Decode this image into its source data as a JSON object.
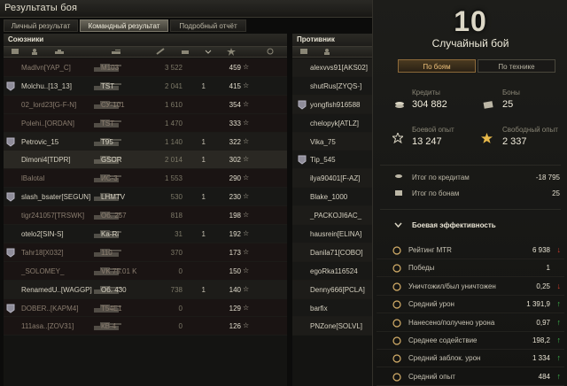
{
  "window": {
    "title": "Результаты боя"
  },
  "tabs": [
    {
      "label": "Личный результат",
      "active": false
    },
    {
      "label": "Командный результат",
      "active": true
    },
    {
      "label": "Подробный отчёт",
      "active": false
    }
  ],
  "allies": {
    "header": "Союзники",
    "rows": [
      {
        "name": "Madlvn[YAP_C]",
        "tank": "M103",
        "damage": "3 522",
        "kills": "",
        "xp": "459",
        "dead": true
      },
      {
        "name": "Molchu..[13_13]",
        "tank": "TST",
        "damage": "2 041",
        "kills": "1",
        "xp": "415",
        "dead": false
      },
      {
        "name": "02_lord23[G-F-N]",
        "tank": "СУ-101",
        "damage": "1 610",
        "kills": "",
        "xp": "354",
        "dead": true
      },
      {
        "name": "Polehi..[ORDAN]",
        "tank": "TST",
        "damage": "1 470",
        "kills": "",
        "xp": "333",
        "dead": true
      },
      {
        "name": "Petrovic_15",
        "tank": "T95",
        "damage": "1 140",
        "kills": "1",
        "xp": "322",
        "dead": false
      },
      {
        "name": "Dimoni4[TDPR]",
        "tank": "GSOR",
        "damage": "2 014",
        "kills": "1",
        "xp": "302",
        "dead": false,
        "me": true
      },
      {
        "name": "lBalotal",
        "tank": "ИС-3",
        "damage": "1 553",
        "kills": "",
        "xp": "290",
        "dead": true
      },
      {
        "name": "slash_bsater[SEGUN]",
        "tank": "LHMTV",
        "damage": "530",
        "kills": "1",
        "xp": "230",
        "dead": false
      },
      {
        "name": "tigr241057[TRSWK]",
        "tank": "Об. 257",
        "damage": "818",
        "kills": "",
        "xp": "198",
        "dead": true
      },
      {
        "name": "otelo2[SIN-S]",
        "tank": "Ka-Ri",
        "damage": "31",
        "kills": "1",
        "xp": "192",
        "dead": false
      },
      {
        "name": "Tahr18[X032]",
        "tank": "110",
        "damage": "370",
        "kills": "",
        "xp": "173",
        "dead": true
      },
      {
        "name": "_SOLOMEY_",
        "tank": "VK 75.01 K",
        "damage": "0",
        "kills": "",
        "xp": "150",
        "dead": true
      },
      {
        "name": "RenamedU..[WAGGP]",
        "tank": "Об. 430",
        "damage": "738",
        "kills": "1",
        "xp": "140",
        "dead": false
      },
      {
        "name": "DOBER..[KAPM4]",
        "tank": "T54E1",
        "damage": "0",
        "kills": "",
        "xp": "129",
        "dead": true
      },
      {
        "name": "111asa..[ZOV31]",
        "tank": "КВ-4",
        "damage": "0",
        "kills": "",
        "xp": "126",
        "dead": true
      }
    ]
  },
  "enemies": {
    "header": "Противник",
    "rows": [
      {
        "name": "alexvvs91[AKS02]"
      },
      {
        "name": "shutRus[ZYQS-]"
      },
      {
        "name": "yongfish916588"
      },
      {
        "name": "chelopyk[ATLZ]"
      },
      {
        "name": "Vika_75"
      },
      {
        "name": "Tip_545"
      },
      {
        "name": "ilya90401[F-AZ]"
      },
      {
        "name": "Blake_1000"
      },
      {
        "name": "_PACKOJI6AC_"
      },
      {
        "name": "hausrein[ELINA]"
      },
      {
        "name": "Danila71[COBO]"
      },
      {
        "name": "egoRka116524"
      },
      {
        "name": "Denny666[PCLA]"
      },
      {
        "name": "barfix"
      },
      {
        "name": "PNZone[SOLVL]"
      }
    ]
  },
  "summary": {
    "tier": "10",
    "battle_type": "Случайный бой",
    "subtabs": [
      {
        "label": "По боям",
        "active": true
      },
      {
        "label": "По технике",
        "active": false
      }
    ],
    "credits_label": "Кредиты",
    "credits_value": "304 882",
    "bonds_label": "Боны",
    "bonds_value": "25",
    "xp_label": "Боевой опыт",
    "xp_value": "13 247",
    "free_xp_label": "Свободный опыт",
    "free_xp_value": "2 337",
    "total_credits_label": "Итог по кредитам",
    "total_credits_value": "-18 795",
    "total_bonds_label": "Итог по бонам",
    "total_bonds_value": "25",
    "efficiency_title": "Боевая эффективность",
    "metrics": [
      {
        "label": "Рейтинг MTR",
        "value": "6 938",
        "trend": "down"
      },
      {
        "label": "Победы",
        "value": "1",
        "trend": ""
      },
      {
        "label": "Уничтожил/был уничтожен",
        "value": "0,25",
        "trend": "down"
      },
      {
        "label": "Средний урон",
        "value": "1 391,9",
        "trend": "up"
      },
      {
        "label": "Нанесено/получено урона",
        "value": "0,97",
        "trend": "up"
      },
      {
        "label": "Среднее содействие",
        "value": "198,2",
        "trend": "up"
      },
      {
        "label": "Средний заблок. урон",
        "value": "1 334",
        "trend": "up"
      },
      {
        "label": "Средний опыт",
        "value": "484",
        "trend": "up"
      }
    ]
  }
}
